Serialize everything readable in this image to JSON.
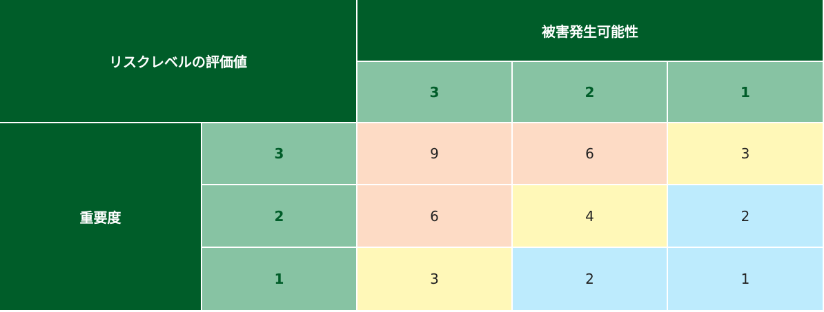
{
  "table": {
    "title": "リスクレベルの評価値",
    "probability_header": "被害発生可能性",
    "importance_header": "重要度",
    "probability_levels": [
      "3",
      "2",
      "1"
    ],
    "importance_levels": [
      "3",
      "2",
      "1"
    ],
    "rows": [
      [
        "9",
        "6",
        "3"
      ],
      [
        "6",
        "4",
        "2"
      ],
      [
        "3",
        "2",
        "1"
      ]
    ],
    "colors": {
      "header_dark": "#005d29",
      "header_light": "#87c3a3",
      "high": "#fddbc5",
      "mid": "#fff8b8",
      "low": "#bdebfd"
    }
  }
}
